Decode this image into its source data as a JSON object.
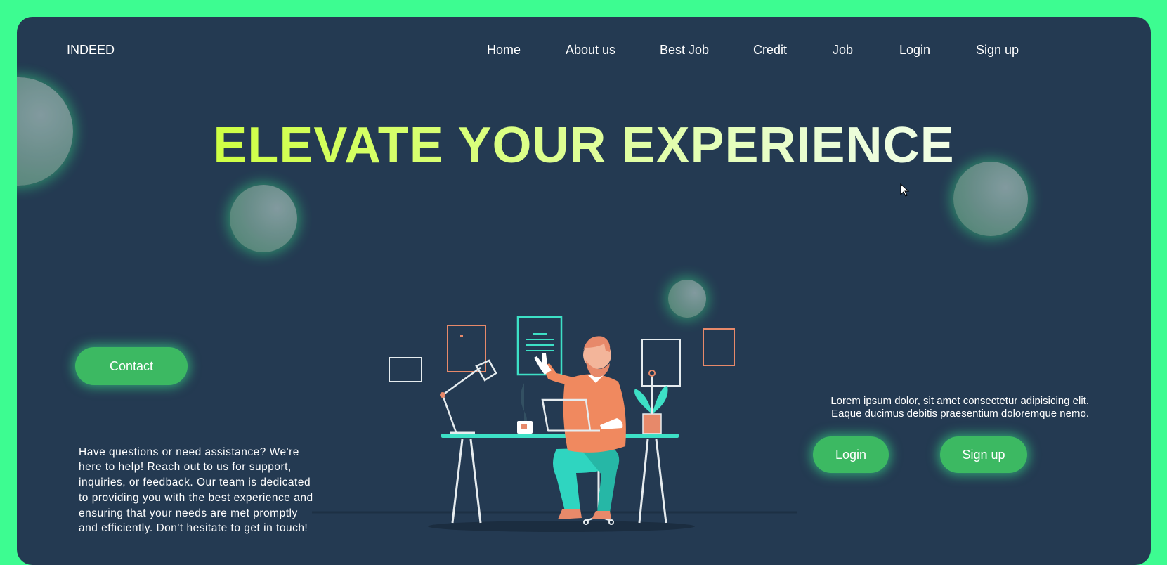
{
  "header": {
    "brand": "INDEED",
    "nav": [
      {
        "label": "Home"
      },
      {
        "label": "About us"
      },
      {
        "label": "Best Job"
      },
      {
        "label": "Credit"
      },
      {
        "label": "Job"
      },
      {
        "label": "Login"
      },
      {
        "label": "Sign up"
      }
    ]
  },
  "hero": {
    "title": "ELEVATE YOUR EXPERIENCE"
  },
  "contact": {
    "button_label": "Contact",
    "text": "Have questions or need assistance? We're here to help! Reach out to us for support, inquiries, or feedback. Our team is dedicated to providing you with the best experience and ensuring that your needs are met promptly and efficiently. Don't hesitate to get in touch!"
  },
  "aside": {
    "text": "Lorem ipsum dolor, sit amet consectetur adipisicing elit. Eaque ducimus debitis praesentium doloremque nemo.",
    "login_label": "Login",
    "signup_label": "Sign up"
  },
  "colors": {
    "page_background": "#3dfc91",
    "card_background": "#243a52",
    "button": "#3cb962",
    "title_gradient_start": "#c6ff1a",
    "title_gradient_end": "#ffffff"
  },
  "icons": [
    "mouse-cursor-icon"
  ]
}
